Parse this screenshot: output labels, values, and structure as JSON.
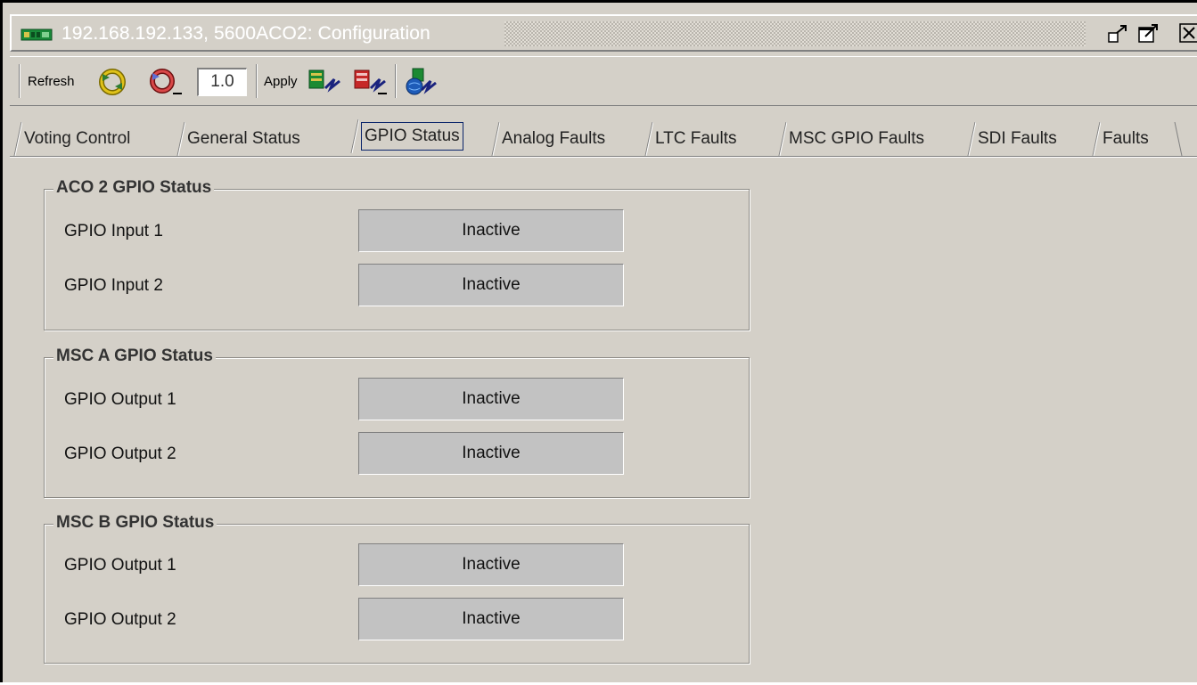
{
  "window": {
    "title": "192.168.192.133, 5600ACO2: Configuration",
    "icon": "network-card-icon",
    "controls": [
      "undock-icon",
      "maximize-icon",
      "close-icon"
    ]
  },
  "toolbar": {
    "refresh_label": "Refresh",
    "version_value": "1.0",
    "apply_label": "Apply",
    "icons": [
      "refresh-icon",
      "refresh-stop-icon",
      "apply-card-icon",
      "apply-card-red-icon",
      "apply-network-icon"
    ]
  },
  "tabs": [
    {
      "label": "Voting Control",
      "active": false
    },
    {
      "label": "General Status",
      "active": false
    },
    {
      "label": "GPIO Status",
      "active": true
    },
    {
      "label": "Analog Faults",
      "active": false
    },
    {
      "label": "LTC Faults",
      "active": false
    },
    {
      "label": "MSC GPIO Faults",
      "active": false
    },
    {
      "label": "SDI Faults",
      "active": false
    },
    {
      "label": "Faults",
      "active": false
    }
  ],
  "groups": [
    {
      "title": "ACO 2 GPIO Status",
      "rows": [
        {
          "label": "GPIO Input 1",
          "value": "Inactive"
        },
        {
          "label": "GPIO Input 2",
          "value": "Inactive"
        }
      ]
    },
    {
      "title": "MSC A GPIO Status",
      "rows": [
        {
          "label": "GPIO Output 1",
          "value": "Inactive"
        },
        {
          "label": "GPIO Output 2",
          "value": "Inactive"
        }
      ]
    },
    {
      "title": "MSC B GPIO Status",
      "rows": [
        {
          "label": "GPIO Output 1",
          "value": "Inactive"
        },
        {
          "label": "GPIO Output 2",
          "value": "Inactive"
        }
      ]
    }
  ],
  "colors": {
    "window_bg": "#d4d0c8",
    "status_box_bg": "#c2c2c2",
    "active_tab_border": "#0a246a"
  }
}
